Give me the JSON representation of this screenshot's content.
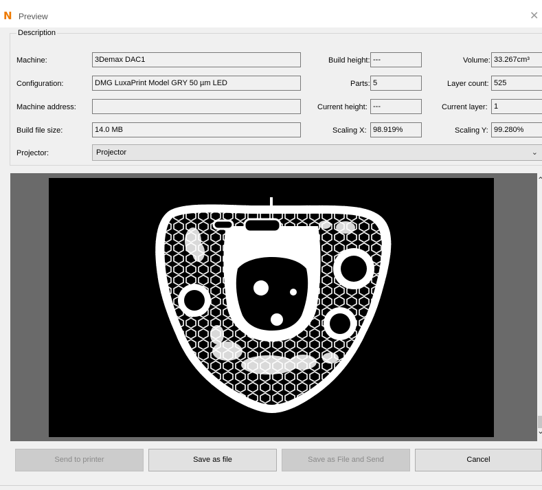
{
  "window": {
    "title": "Preview",
    "app_icon": "N",
    "close_glyph": "✕"
  },
  "description": {
    "legend": "Description",
    "machine": {
      "label": "Machine:",
      "value": "3Demax DAC1"
    },
    "configuration": {
      "label": "Configuration:",
      "value": "DMG LuxaPrint Model GRY 50 µm LED"
    },
    "machine_address": {
      "label": "Machine address:",
      "value": ""
    },
    "build_file_size": {
      "label": "Build file size:",
      "value": "14.0 MB"
    },
    "projector": {
      "label": "Projector:",
      "value": "Projector"
    },
    "build_height": {
      "label": "Build height:",
      "value": "---"
    },
    "parts": {
      "label": "Parts:",
      "value": "5"
    },
    "current_height": {
      "label": "Current height:",
      "value": "---"
    },
    "scaling_x": {
      "label": "Scaling X:",
      "value": "98.919%"
    },
    "volume": {
      "label": "Volume:",
      "value": "33.267cm³"
    },
    "layer_count": {
      "label": "Layer count:",
      "value": "525"
    },
    "current_layer": {
      "label": "Current layer:",
      "value": "1"
    },
    "scaling_y": {
      "label": "Scaling Y:",
      "value": "99.280%"
    }
  },
  "buttons": {
    "send_to_printer": "Send to printer",
    "save_as_file": "Save as file",
    "save_as_file_and_send": "Save as File and Send",
    "cancel": "Cancel"
  },
  "colors": {
    "app_icon": "#ee7a00",
    "canvas": "#000000",
    "slice": "#ffffff"
  }
}
